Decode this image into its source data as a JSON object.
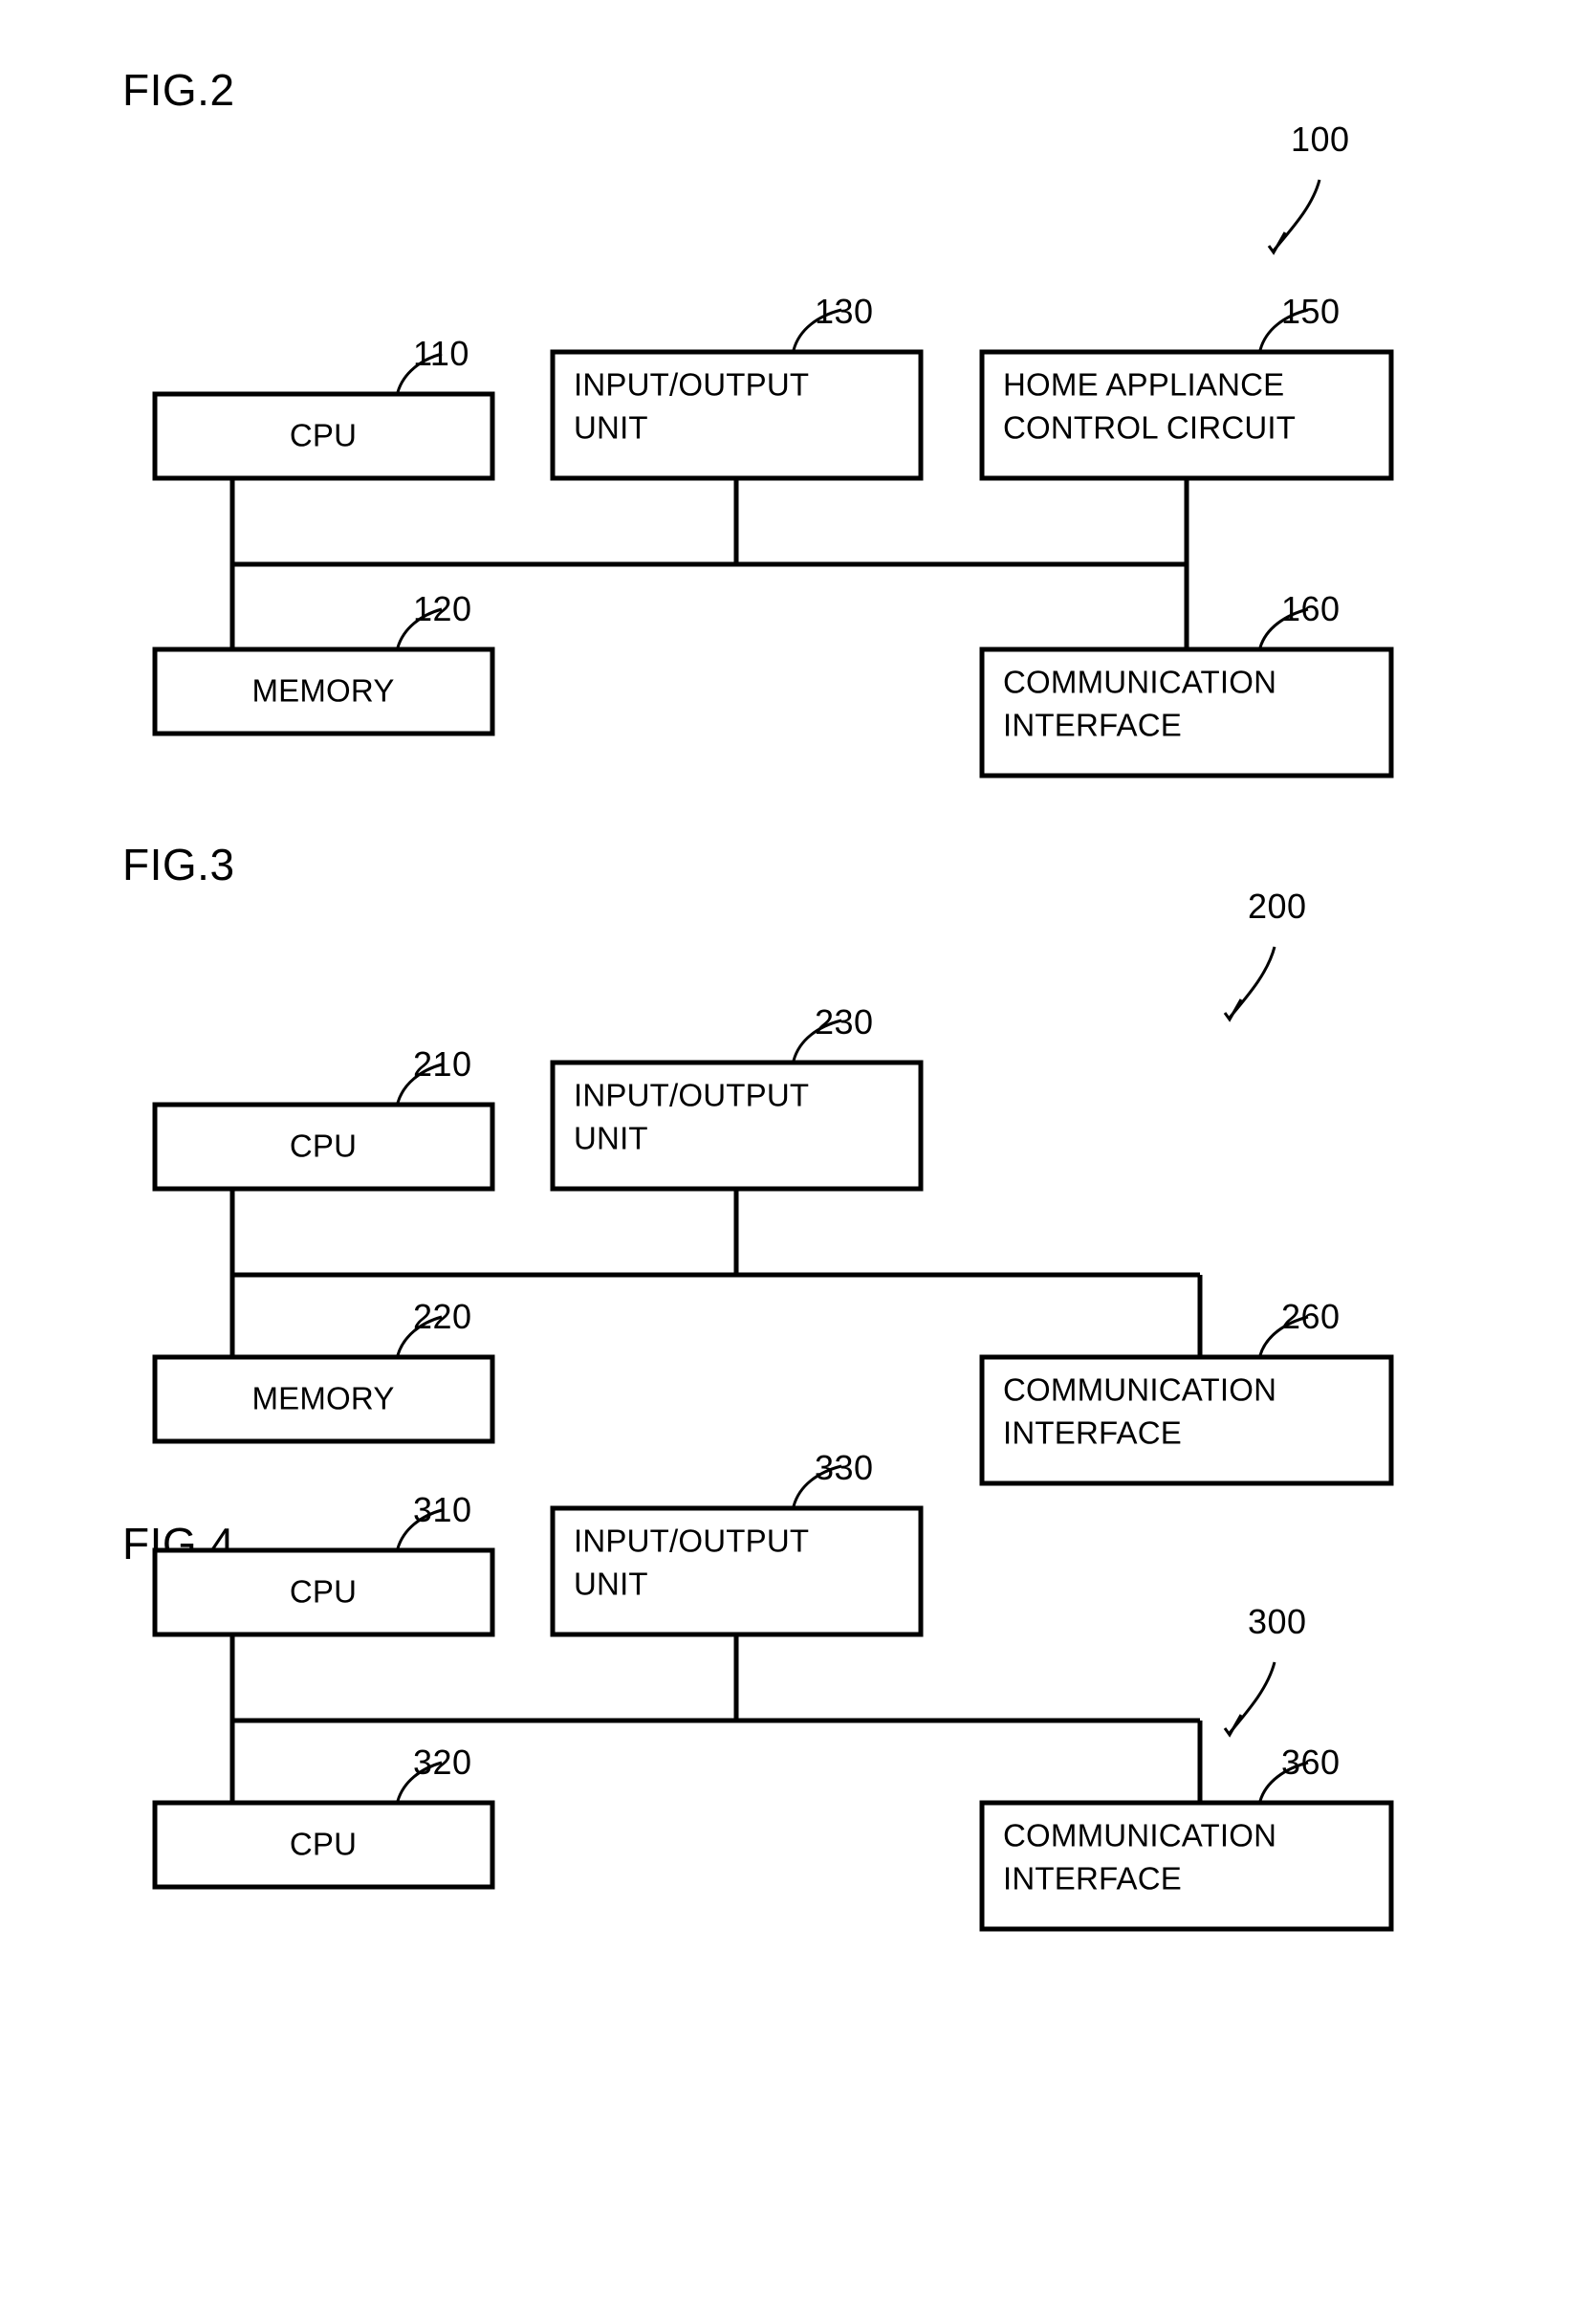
{
  "document": {
    "type": "patent-drawing-sheet",
    "background_color": "#ffffff",
    "ink_color": "#000000"
  },
  "figures": [
    {
      "id": "fig2",
      "label": "FIG.2",
      "system_number": "100",
      "boxes": [
        {
          "id": "cpu",
          "label": "CPU",
          "ref": "110",
          "align": "center"
        },
        {
          "id": "io",
          "label_line1": "INPUT/OUTPUT",
          "label_line2": "UNIT",
          "ref": "130",
          "align": "left"
        },
        {
          "id": "hacc",
          "label_line1": "HOME APPLIANCE",
          "label_line2": "CONTROL CIRCUIT",
          "ref": "150",
          "align": "left"
        },
        {
          "id": "memory",
          "label": "MEMORY",
          "ref": "120",
          "align": "center"
        },
        {
          "id": "comm",
          "label_line1": "COMMUNICATION",
          "label_line2": "INTERFACE",
          "ref": "160",
          "align": "left"
        }
      ]
    },
    {
      "id": "fig3",
      "label": "FIG.3",
      "system_number": "200",
      "boxes": [
        {
          "id": "cpu",
          "label": "CPU",
          "ref": "210",
          "align": "center"
        },
        {
          "id": "io",
          "label_line1": "INPUT/OUTPUT",
          "label_line2": "UNIT",
          "ref": "230",
          "align": "left"
        },
        {
          "id": "memory",
          "label": "MEMORY",
          "ref": "220",
          "align": "center"
        },
        {
          "id": "comm",
          "label_line1": "COMMUNICATION",
          "label_line2": "INTERFACE",
          "ref": "260",
          "align": "left"
        }
      ]
    },
    {
      "id": "fig4",
      "label": "FIG.4",
      "system_number": "300",
      "boxes": [
        {
          "id": "cpu1",
          "label": "CPU",
          "ref": "310",
          "align": "center"
        },
        {
          "id": "io",
          "label_line1": "INPUT/OUTPUT",
          "label_line2": "UNIT",
          "ref": "330",
          "align": "left"
        },
        {
          "id": "cpu2",
          "label": "CPU",
          "ref": "320",
          "align": "center"
        },
        {
          "id": "comm",
          "label_line1": "COMMUNICATION",
          "label_line2": "INTERFACE",
          "ref": "360",
          "align": "left"
        }
      ]
    }
  ]
}
